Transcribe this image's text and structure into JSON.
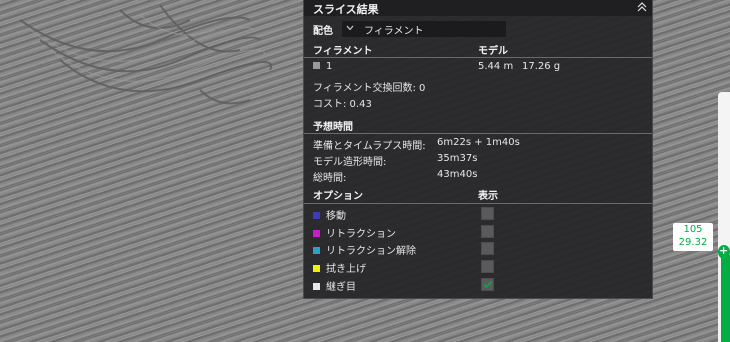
{
  "panel": {
    "title": "スライス結果",
    "color_scheme_label": "配色",
    "color_scheme_value": "フィラメント",
    "filament_header": "フィラメント",
    "model_header": "モデル",
    "filament_row": {
      "index": "1",
      "length": "5.44 m",
      "weight": "17.26 g",
      "swatch_color": "#9a9a9a"
    },
    "filament_changes": "フィラメント交換回数:  0",
    "cost": "コスト:  0.43",
    "time_header": "予想時間",
    "prep_label": "準備とタイムラプス時間:",
    "prep_value": "6m22s + 1m40s",
    "model_time_label": "モデル造形時間:",
    "model_time_value": "35m37s",
    "total_label": "総時間:",
    "total_value": "43m40s",
    "options_header": "オプション",
    "display_header": "表示",
    "options": [
      {
        "label": "移動",
        "color": "#3d3db8",
        "checked": false
      },
      {
        "label": "リトラクション",
        "color": "#c81ec8",
        "checked": false
      },
      {
        "label": "リトラクション解除",
        "color": "#2ea0c8",
        "checked": false
      },
      {
        "label": "拭き上げ",
        "color": "#f0f000",
        "checked": false
      },
      {
        "label": "継ぎ目",
        "color": "#e8e8e8",
        "checked": true
      }
    ]
  },
  "layer_slider": {
    "layer_number": "105",
    "height": "29.32",
    "accent": "#00ae42"
  }
}
